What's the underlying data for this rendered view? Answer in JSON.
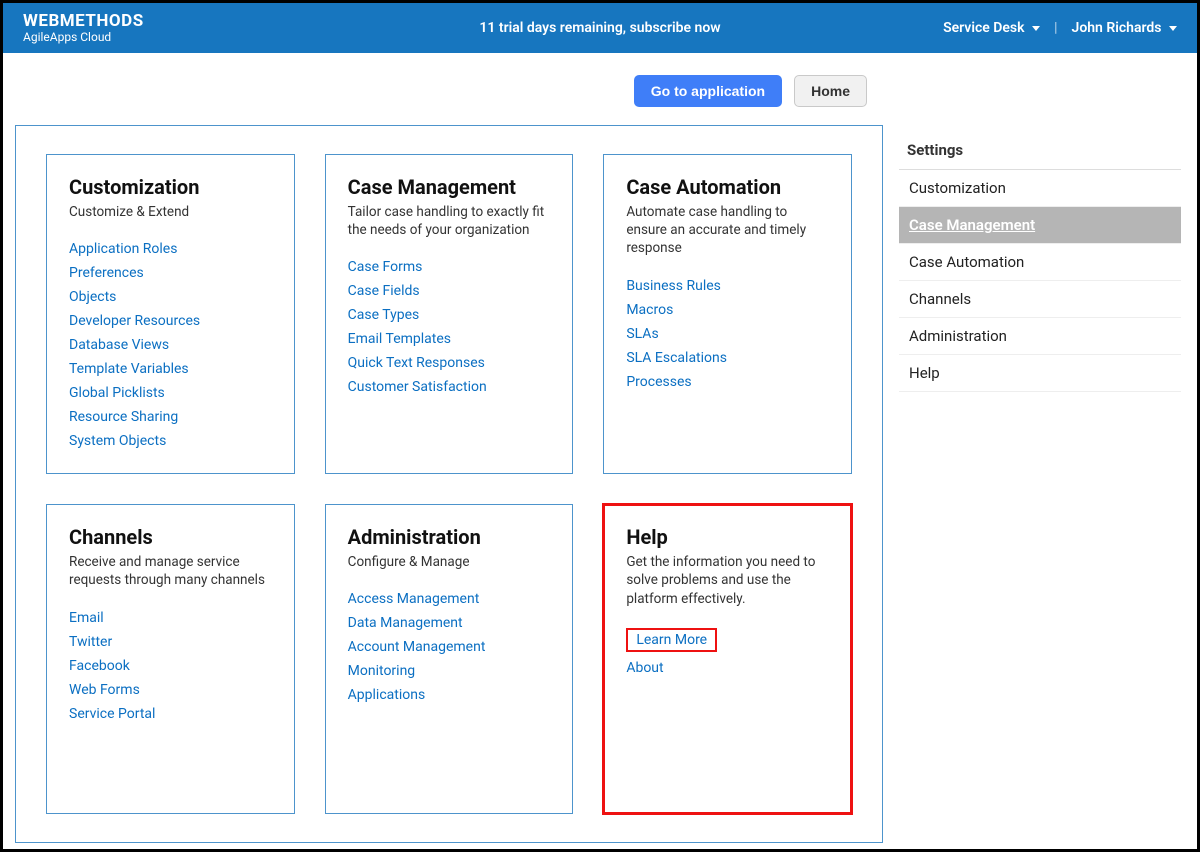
{
  "header": {
    "brand_main": "WEBMETHODS",
    "brand_sub": "AgileApps Cloud",
    "trial_text": "11 trial days remaining, subscribe now",
    "service_desk": "Service Desk",
    "user_name": "John Richards"
  },
  "actions": {
    "go_to_app": "Go to application",
    "home": "Home"
  },
  "cards": {
    "customization": {
      "title": "Customization",
      "desc": "Customize & Extend",
      "links": [
        "Application Roles",
        "Preferences",
        "Objects",
        "Developer Resources",
        "Database Views",
        "Template Variables",
        "Global Picklists",
        "Resource Sharing",
        "System Objects"
      ]
    },
    "case_management": {
      "title": "Case Management",
      "desc": "Tailor case handling to exactly fit the needs of your organization",
      "links": [
        "Case Forms",
        "Case Fields",
        "Case Types",
        "Email Templates",
        "Quick Text Responses",
        "Customer Satisfaction"
      ]
    },
    "case_automation": {
      "title": "Case Automation",
      "desc": "Automate case handling to ensure an accurate and timely response",
      "links": [
        "Business Rules",
        "Macros",
        "SLAs",
        "SLA Escalations",
        "Processes"
      ]
    },
    "channels": {
      "title": "Channels",
      "desc": "Receive and manage service requests through many channels",
      "links": [
        "Email",
        "Twitter",
        "Facebook",
        "Web Forms",
        "Service Portal"
      ]
    },
    "administration": {
      "title": "Administration",
      "desc": "Configure & Manage",
      "links": [
        "Access Management",
        "Data Management",
        "Account Management",
        "Monitoring",
        "Applications"
      ]
    },
    "help": {
      "title": "Help",
      "desc": "Get the information you need to solve problems and use the platform effectively.",
      "links": [
        "Learn More",
        "About"
      ]
    }
  },
  "sidebar": {
    "title": "Settings",
    "items": [
      "Customization",
      "Case Management",
      "Case Automation",
      "Channels",
      "Administration",
      "Help"
    ],
    "active_index": 1
  }
}
